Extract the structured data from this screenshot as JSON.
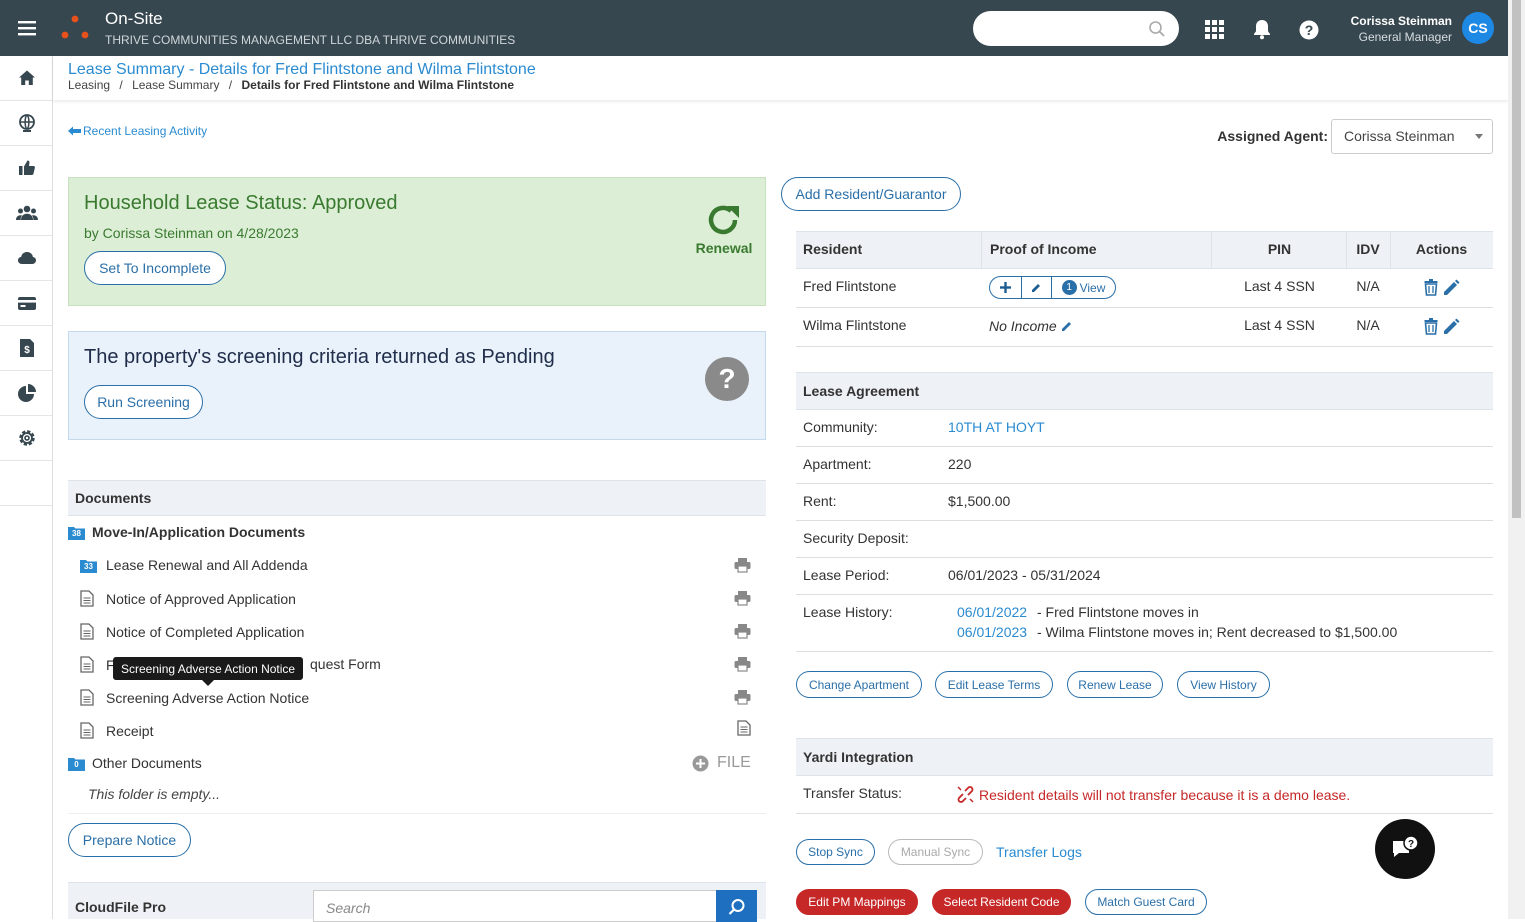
{
  "app": {
    "name": "On-Site",
    "company": "THRIVE COMMUNITIES MANAGEMENT LLC DBA THRIVE COMMUNITIES",
    "user_name": "Corissa Steinman",
    "user_role": "General Manager",
    "user_initials": "CS",
    "search_placeholder": ""
  },
  "sidebar": {
    "items": [
      {
        "icon": "home-icon"
      },
      {
        "icon": "globe-icon"
      },
      {
        "icon": "thumbs-up-icon"
      },
      {
        "icon": "people-icon"
      },
      {
        "icon": "cloud-icon"
      },
      {
        "icon": "credit-card-icon"
      },
      {
        "icon": "document-dollar-icon"
      },
      {
        "icon": "pie-chart-icon"
      },
      {
        "icon": "gear-icon"
      }
    ]
  },
  "header": {
    "title": "Lease Summary - Details for Fred Flintstone and Wilma Flintstone",
    "breadcrumb": [
      "Leasing",
      "Lease Summary",
      "Details for Fred Flintstone and Wilma Flintstone"
    ],
    "separator": "/"
  },
  "back_link": "Recent Leasing Activity",
  "assigned_agent": {
    "label": "Assigned Agent:",
    "value": "Corissa Steinman"
  },
  "status_box": {
    "title": "Household Lease Status: Approved",
    "subtitle": "by Corissa Steinman on 4/28/2023",
    "button": "Set To Incomplete",
    "icon_label": "Renewal"
  },
  "screening_box": {
    "title": "The property's screening criteria returned as Pending",
    "button": "Run Screening"
  },
  "documents": {
    "heading": "Documents",
    "folder1": {
      "name": "Move-In/Application Documents",
      "count": "38"
    },
    "items": [
      {
        "name": "Lease Renewal and All Addenda",
        "count": "33"
      },
      {
        "name": "Notice of Approved Application"
      },
      {
        "name": "Notice of Completed Application"
      },
      {
        "name_start": "F",
        "name_end": "quest Form"
      },
      {
        "name": "Screening Adverse Action Notice"
      },
      {
        "name": "Receipt"
      }
    ],
    "tooltip": "Screening Adverse Action Notice",
    "folder2": {
      "name": "Other Documents",
      "count": "0",
      "file_label": "FILE"
    },
    "empty_text": "This folder is empty...",
    "prepare_button": "Prepare Notice"
  },
  "cloudfile": {
    "title": "CloudFile Pro",
    "search_placeholder": "Search"
  },
  "residents": {
    "add_button": "Add Resident/Guarantor",
    "columns": [
      "Resident",
      "Proof of Income",
      "PIN",
      "IDV",
      "Actions"
    ],
    "rows": [
      {
        "name": "Fred Flintstone",
        "income_count": "1",
        "income_view": "View",
        "pin": "Last 4 SSN",
        "idv": "N/A"
      },
      {
        "name": "Wilma Flintstone",
        "income_text": "No Income",
        "pin": "Last 4 SSN",
        "idv": "N/A"
      }
    ]
  },
  "lease_agreement": {
    "heading": "Lease Agreement",
    "community_label": "Community:",
    "community": "10TH AT HOYT",
    "apartment_label": "Apartment:",
    "apartment": "220",
    "rent_label": "Rent:",
    "rent": "$1,500.00",
    "deposit_label": "Security Deposit:",
    "deposit": "",
    "period_label": "Lease Period:",
    "period": "06/01/2023 - 05/31/2024",
    "history_label": "Lease History:",
    "history": [
      {
        "date": "06/01/2022",
        "text": "-  Fred Flintstone moves in"
      },
      {
        "date": "06/01/2023",
        "text": "-  Wilma Flintstone moves in; Rent decreased to $1,500.00"
      }
    ],
    "buttons": [
      "Change Apartment",
      "Edit Lease Terms",
      "Renew Lease",
      "View History"
    ]
  },
  "yardi": {
    "heading": "Yardi Integration",
    "transfer_label": "Transfer Status:",
    "transfer_message": "Resident details will not transfer because it is a demo lease.",
    "stop_sync": "Stop Sync",
    "manual_sync": "Manual Sync",
    "transfer_logs": "Transfer Logs",
    "edit_pm": "Edit PM Mappings",
    "select_resident": "Select Resident Code",
    "match_guest": "Match Guest Card"
  },
  "colors": {
    "topbar": "#37474f",
    "accent": "#2a6fa8",
    "link": "#2a8bd1",
    "approved_bg": "#dcefd6",
    "approved_text": "#3a7a30",
    "pending_bg": "#e9f1fa",
    "danger": "#c62828",
    "logo": "#e8501c"
  }
}
